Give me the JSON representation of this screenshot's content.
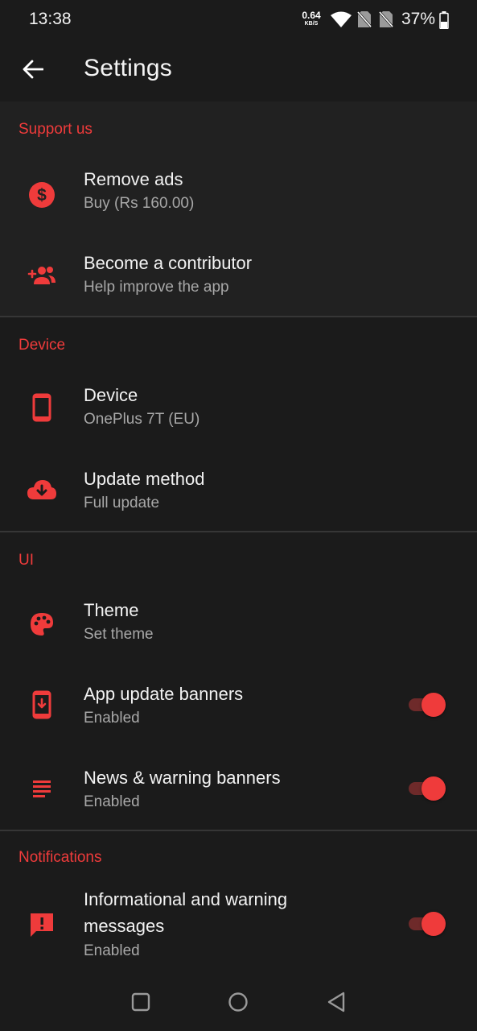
{
  "status_bar": {
    "time": "13:38",
    "net_speed_value": "0.64",
    "net_speed_unit": "KB/S",
    "battery_percent": "37%",
    "icons": [
      "wifi-icon",
      "no-sim-icon",
      "no-sim-icon",
      "battery-icon"
    ]
  },
  "app_bar": {
    "title": "Settings",
    "back_icon": "arrow-back-icon"
  },
  "sections": {
    "support": {
      "header": "Support us",
      "remove_ads": {
        "title": "Remove ads",
        "subtitle": "Buy (Rs 160.00)",
        "icon": "dollar-circle-icon"
      },
      "contributor": {
        "title": "Become a contributor",
        "subtitle": "Help improve the app",
        "icon": "group-add-icon"
      }
    },
    "device": {
      "header": "Device",
      "device": {
        "title": "Device",
        "subtitle": "OnePlus 7T (EU)",
        "icon": "smartphone-icon"
      },
      "update_method": {
        "title": "Update method",
        "subtitle": "Full update",
        "icon": "cloud-download-icon"
      }
    },
    "ui": {
      "header": "UI",
      "theme": {
        "title": "Theme",
        "subtitle": "Set theme",
        "icon": "palette-icon"
      },
      "app_update_banners": {
        "title": "App update banners",
        "subtitle": "Enabled",
        "icon": "phone-download-icon",
        "toggle_on": true
      },
      "news_banners": {
        "title": "News & warning banners",
        "subtitle": "Enabled",
        "icon": "notes-icon",
        "toggle_on": true
      }
    },
    "notifications": {
      "header": "Notifications",
      "info_messages": {
        "title_line1": "Informational and warning",
        "title_line2": "messages",
        "subtitle": "Enabled",
        "icon": "alert-message-icon",
        "toggle_on": true
      }
    }
  },
  "nav_bar": {
    "icons": [
      "recents-square-icon",
      "home-circle-icon",
      "back-triangle-icon"
    ]
  },
  "colors": {
    "accent": "#ef3b3b",
    "background": "#1b1b1b",
    "card_background": "#212121",
    "subtitle_text": "#a8a8a8",
    "toggle_track": "#6e2a2a"
  }
}
